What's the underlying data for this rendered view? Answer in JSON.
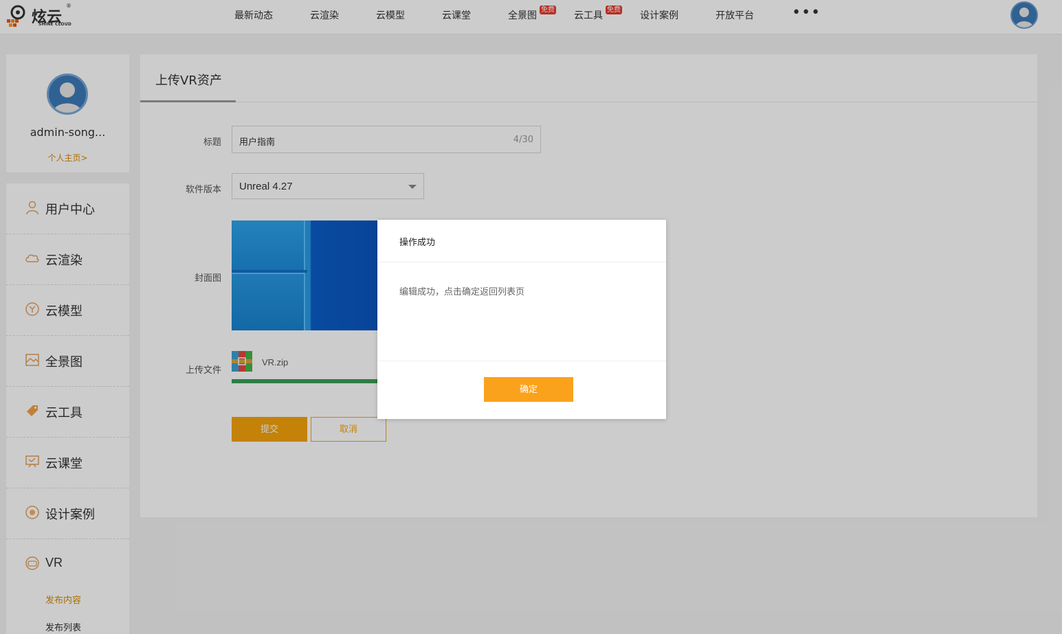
{
  "brand": {
    "name": "炫云",
    "tagline": "SHINE CLOUD",
    "registered": "®"
  },
  "nav": {
    "items": [
      {
        "label": "最新动态"
      },
      {
        "label": "云渲染"
      },
      {
        "label": "云模型"
      },
      {
        "label": "云课堂"
      },
      {
        "label": "全景图",
        "badge": "免费"
      },
      {
        "label": "云工具",
        "badge": "免费"
      },
      {
        "label": "设计案例"
      },
      {
        "label": "开放平台"
      }
    ],
    "more": "•••"
  },
  "profile": {
    "name": "admin-song...",
    "link": "个人主页>"
  },
  "menu": {
    "items": [
      {
        "label": "用户中心",
        "icon": "user-icon"
      },
      {
        "label": "云渲染",
        "icon": "cloud-icon"
      },
      {
        "label": "云模型",
        "icon": "model-icon"
      },
      {
        "label": "全景图",
        "icon": "panorama-icon"
      },
      {
        "label": "云工具",
        "icon": "tag-icon"
      },
      {
        "label": "云课堂",
        "icon": "classroom-icon"
      },
      {
        "label": "设计案例",
        "icon": "case-icon"
      },
      {
        "label": "VR",
        "icon": "vr-icon"
      }
    ],
    "sub_items": [
      {
        "label": "发布内容",
        "active": true
      },
      {
        "label": "发布列表",
        "active": false
      }
    ]
  },
  "main": {
    "title": "上传VR资产",
    "form": {
      "title_label": "标题",
      "title_value": "用户指南",
      "title_count": "4/30",
      "version_label": "软件版本",
      "version_value": "Unreal 4.27",
      "cover_label": "封面图",
      "file_label": "上传文件",
      "file_name": "VR.zip",
      "upload_progress": 1.0,
      "submit": "提交",
      "cancel": "取消"
    }
  },
  "modal": {
    "title": "操作成功",
    "message": "编辑成功，点击确定返回列表页",
    "ok": "确定"
  },
  "colors": {
    "accent": "#f5a30b",
    "modal_button": "#fba21c",
    "progress": "#3a9d56",
    "badge": "#e63b2e"
  }
}
